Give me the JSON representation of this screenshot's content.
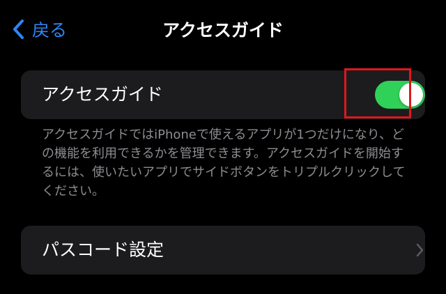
{
  "nav": {
    "back_label": "戻る",
    "title": "アクセスガイド"
  },
  "guided_access": {
    "label": "アクセスガイド",
    "enabled": true,
    "description": "アクセスガイドではiPhoneで使えるアプリが1つだけになり、どの機能を利用できるかを管理できます。アクセスガイドを開始するには、使いたいアプリでサイドボタンをトリプルクリックしてください。"
  },
  "passcode": {
    "label": "パスコード設定"
  },
  "colors": {
    "background": "#000000",
    "group_background": "#1c1c1e",
    "accent_blue": "#2f86f6",
    "toggle_on": "#30d158",
    "secondary_text": "#8d8d93",
    "highlight": "#e0161b"
  },
  "icons": {
    "back": "chevron-left-icon",
    "disclosure": "chevron-right-icon"
  }
}
